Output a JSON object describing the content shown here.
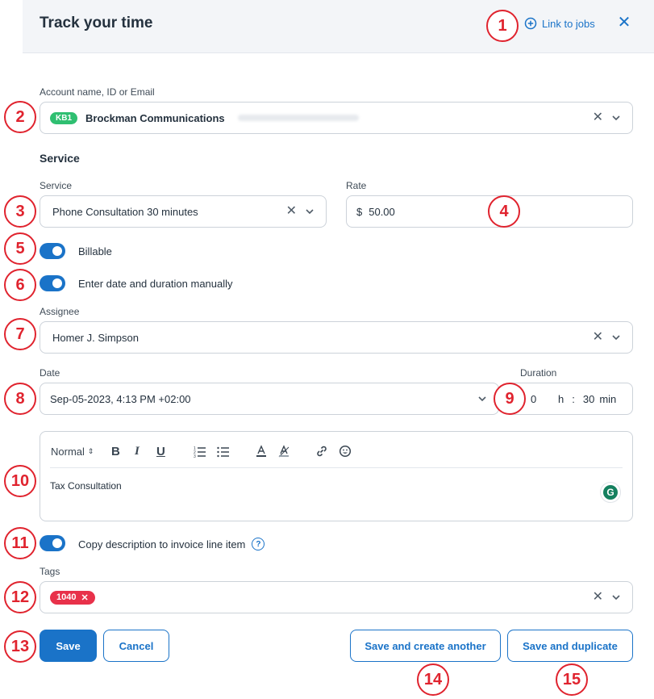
{
  "header": {
    "title": "Track your time",
    "link_jobs": "Link to jobs",
    "close_icon": "close-icon"
  },
  "account": {
    "label": "Account name, ID or Email",
    "badge": "KB1",
    "name": "Brockman Communications"
  },
  "service_section": {
    "title": "Service"
  },
  "service": {
    "label": "Service",
    "value": "Phone Consultation 30 minutes"
  },
  "rate": {
    "label": "Rate",
    "currency": "$",
    "value": "50.00"
  },
  "toggles": {
    "billable": "Billable",
    "manual": "Enter date and duration manually",
    "copy_desc": "Copy description to invoice line item"
  },
  "assignee": {
    "label": "Assignee",
    "value": "Homer J. Simpson"
  },
  "date": {
    "label": "Date",
    "value": "Sep-05-2023, 4:13 PM +02:00"
  },
  "duration": {
    "label": "Duration",
    "hours": "0",
    "h_unit": "h",
    "sep": ":",
    "minutes": "30",
    "min_unit": "min"
  },
  "editor": {
    "style_select": "Normal",
    "text": "Tax Consultation",
    "grammarly": "G"
  },
  "tags": {
    "label": "Tags",
    "chip": "1040"
  },
  "buttons": {
    "save": "Save",
    "cancel": "Cancel",
    "save_create": "Save and create another",
    "save_duplicate": "Save and duplicate"
  },
  "markers": [
    "1",
    "2",
    "3",
    "4",
    "5",
    "6",
    "7",
    "8",
    "9",
    "10",
    "11",
    "12",
    "13",
    "14",
    "15"
  ],
  "colors": {
    "accent": "#1a73c8",
    "badge_green": "#2fbf71",
    "tag_red": "#e8314a",
    "marker_red": "#e0232e"
  }
}
